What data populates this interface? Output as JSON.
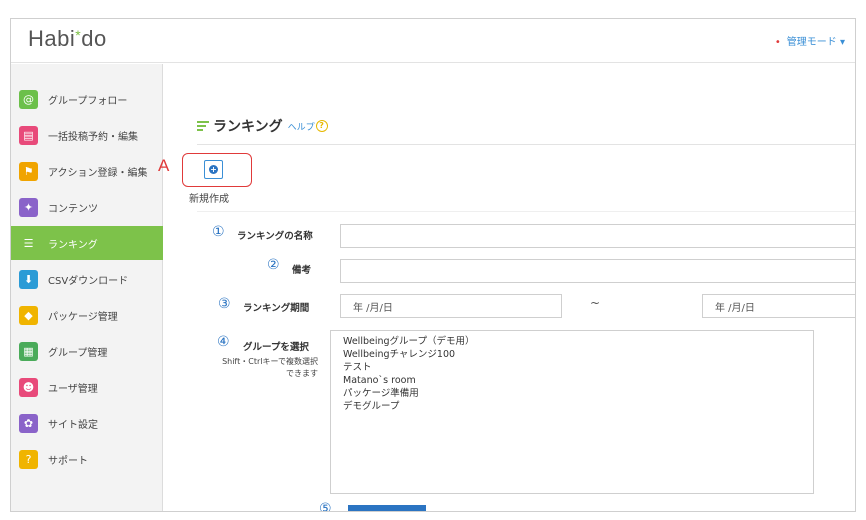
{
  "header": {
    "logo_prefix": "Habi",
    "logo_star": "*",
    "logo_suffix": "do",
    "mode_dot": "•",
    "mode_label": "管理モード ▾"
  },
  "sidebar": {
    "items": [
      {
        "label": "グループフォロー",
        "icon": "ear-icon",
        "glyph": "@",
        "color": "#6cc04a"
      },
      {
        "label": "一括投稿予約・編集",
        "icon": "chat-icon",
        "glyph": "▤",
        "color": "#e84a7a"
      },
      {
        "label": "アクション登録・編集",
        "icon": "flag-icon",
        "glyph": "⚑",
        "color": "#f0a400"
      },
      {
        "label": "コンテンツ",
        "icon": "book-icon",
        "glyph": "✦",
        "color": "#8a63c9"
      },
      {
        "label": "ランキング",
        "icon": "ranking-icon",
        "glyph": "☰",
        "color": "#7dc24a",
        "active": true
      },
      {
        "label": "CSVダウンロード",
        "icon": "download-icon",
        "glyph": "⬇",
        "color": "#2b9bd6"
      },
      {
        "label": "パッケージ管理",
        "icon": "package-icon",
        "glyph": "◆",
        "color": "#f0b400"
      },
      {
        "label": "グループ管理",
        "icon": "group-grid-icon",
        "glyph": "▦",
        "color": "#4aab5a"
      },
      {
        "label": "ユーザ管理",
        "icon": "users-icon",
        "glyph": "☻",
        "color": "#e84a7a"
      },
      {
        "label": "サイト設定",
        "icon": "gear-icon",
        "glyph": "✿",
        "color": "#8a63c9"
      },
      {
        "label": "サポート",
        "icon": "help-circle-icon",
        "glyph": "?",
        "color": "#f0b400"
      }
    ]
  },
  "main": {
    "title": "ランキング",
    "help": "ヘルプ",
    "help_glyph": "?",
    "marker_a": "A",
    "new_label": "新規作成",
    "fields": {
      "name": {
        "num": "①",
        "label": "ランキングの名称",
        "value": ""
      },
      "note": {
        "num": "②",
        "label": "備考",
        "value": ""
      },
      "period": {
        "num": "③",
        "label": "ランキング期間",
        "start_placeholder": "年 /月/日",
        "end_placeholder": "年 /月/日",
        "tilde": "~"
      },
      "group": {
        "num": "④",
        "label": "グループを選択",
        "hint_line1": "Shift・Ctrlキーで複数選択",
        "hint_line2": "できます"
      }
    },
    "groups": [
      "Wellbeingグループ（デモ用）",
      "Wellbeingチャレンジ100",
      "テスト",
      "Matano`s room",
      "パッケージ準備用",
      "デモグループ"
    ],
    "submit": {
      "num": "⑤",
      "label": "＞＞⬇＜＜"
    }
  },
  "colors": {
    "accent_green": "#7dc24a",
    "link_blue": "#2b74c2",
    "highlight_red": "#e03a3a"
  }
}
